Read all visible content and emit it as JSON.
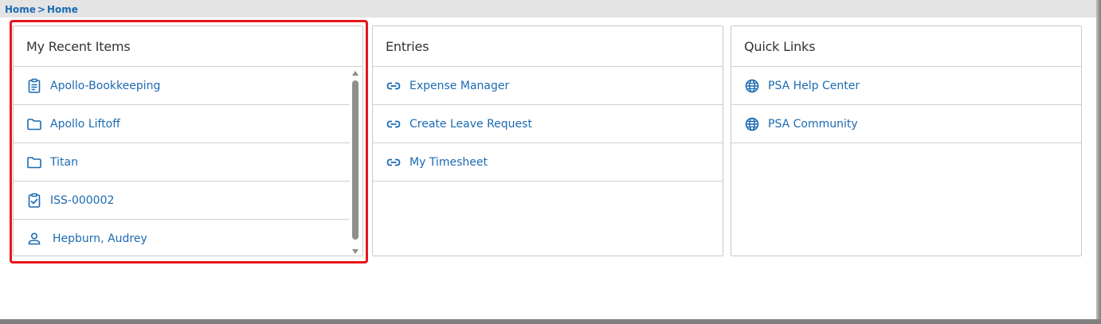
{
  "breadcrumb": {
    "items": [
      "Home",
      "Home"
    ],
    "separator": ">"
  },
  "cards": [
    {
      "title": "My Recent Items",
      "items": [
        {
          "icon": "clipboard-icon",
          "label": "Apollo-Bookkeeping"
        },
        {
          "icon": "folder-icon",
          "label": "Apollo Liftoff"
        },
        {
          "icon": "folder-icon",
          "label": "Titan"
        },
        {
          "icon": "clipboard-check-icon",
          "label": "ISS-000002"
        },
        {
          "icon": "person-icon",
          "label": "Hepburn, Audrey"
        }
      ]
    },
    {
      "title": "Entries",
      "items": [
        {
          "icon": "link-icon",
          "label": "Expense Manager"
        },
        {
          "icon": "link-icon",
          "label": "Create Leave Request"
        },
        {
          "icon": "link-icon",
          "label": "My Timesheet"
        }
      ]
    },
    {
      "title": "Quick Links",
      "items": [
        {
          "icon": "globe-icon",
          "label": "PSA Help Center"
        },
        {
          "icon": "globe-icon",
          "label": "PSA Community"
        }
      ]
    }
  ],
  "colors": {
    "link": "#1b6ab2",
    "highlight": "#e8151b",
    "breadcrumb_bar": "#e4e4e4"
  }
}
